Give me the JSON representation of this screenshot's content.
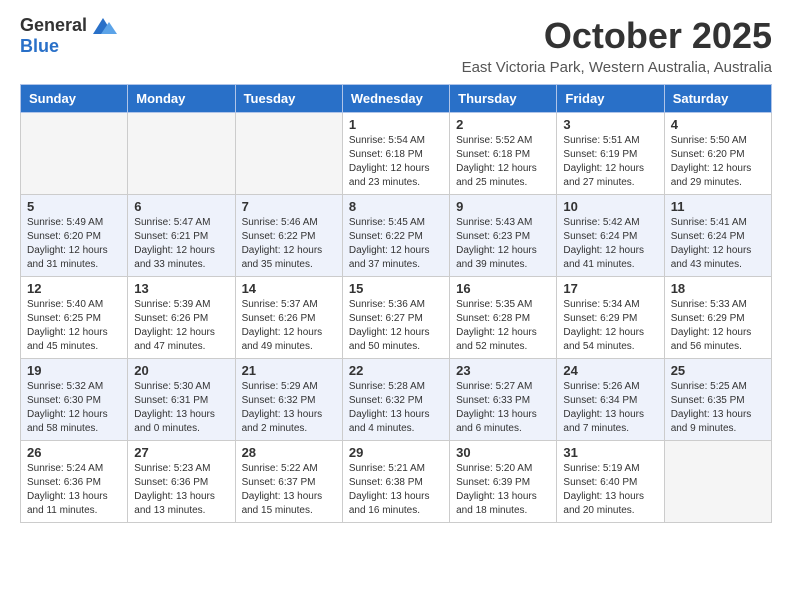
{
  "header": {
    "logo_general": "General",
    "logo_blue": "Blue",
    "title": "October 2025",
    "subtitle": "East Victoria Park, Western Australia, Australia"
  },
  "weekdays": [
    "Sunday",
    "Monday",
    "Tuesday",
    "Wednesday",
    "Thursday",
    "Friday",
    "Saturday"
  ],
  "weeks": [
    [
      {
        "day": "",
        "info": ""
      },
      {
        "day": "",
        "info": ""
      },
      {
        "day": "",
        "info": ""
      },
      {
        "day": "1",
        "info": "Sunrise: 5:54 AM\nSunset: 6:18 PM\nDaylight: 12 hours\nand 23 minutes."
      },
      {
        "day": "2",
        "info": "Sunrise: 5:52 AM\nSunset: 6:18 PM\nDaylight: 12 hours\nand 25 minutes."
      },
      {
        "day": "3",
        "info": "Sunrise: 5:51 AM\nSunset: 6:19 PM\nDaylight: 12 hours\nand 27 minutes."
      },
      {
        "day": "4",
        "info": "Sunrise: 5:50 AM\nSunset: 6:20 PM\nDaylight: 12 hours\nand 29 minutes."
      }
    ],
    [
      {
        "day": "5",
        "info": "Sunrise: 5:49 AM\nSunset: 6:20 PM\nDaylight: 12 hours\nand 31 minutes."
      },
      {
        "day": "6",
        "info": "Sunrise: 5:47 AM\nSunset: 6:21 PM\nDaylight: 12 hours\nand 33 minutes."
      },
      {
        "day": "7",
        "info": "Sunrise: 5:46 AM\nSunset: 6:22 PM\nDaylight: 12 hours\nand 35 minutes."
      },
      {
        "day": "8",
        "info": "Sunrise: 5:45 AM\nSunset: 6:22 PM\nDaylight: 12 hours\nand 37 minutes."
      },
      {
        "day": "9",
        "info": "Sunrise: 5:43 AM\nSunset: 6:23 PM\nDaylight: 12 hours\nand 39 minutes."
      },
      {
        "day": "10",
        "info": "Sunrise: 5:42 AM\nSunset: 6:24 PM\nDaylight: 12 hours\nand 41 minutes."
      },
      {
        "day": "11",
        "info": "Sunrise: 5:41 AM\nSunset: 6:24 PM\nDaylight: 12 hours\nand 43 minutes."
      }
    ],
    [
      {
        "day": "12",
        "info": "Sunrise: 5:40 AM\nSunset: 6:25 PM\nDaylight: 12 hours\nand 45 minutes."
      },
      {
        "day": "13",
        "info": "Sunrise: 5:39 AM\nSunset: 6:26 PM\nDaylight: 12 hours\nand 47 minutes."
      },
      {
        "day": "14",
        "info": "Sunrise: 5:37 AM\nSunset: 6:26 PM\nDaylight: 12 hours\nand 49 minutes."
      },
      {
        "day": "15",
        "info": "Sunrise: 5:36 AM\nSunset: 6:27 PM\nDaylight: 12 hours\nand 50 minutes."
      },
      {
        "day": "16",
        "info": "Sunrise: 5:35 AM\nSunset: 6:28 PM\nDaylight: 12 hours\nand 52 minutes."
      },
      {
        "day": "17",
        "info": "Sunrise: 5:34 AM\nSunset: 6:29 PM\nDaylight: 12 hours\nand 54 minutes."
      },
      {
        "day": "18",
        "info": "Sunrise: 5:33 AM\nSunset: 6:29 PM\nDaylight: 12 hours\nand 56 minutes."
      }
    ],
    [
      {
        "day": "19",
        "info": "Sunrise: 5:32 AM\nSunset: 6:30 PM\nDaylight: 12 hours\nand 58 minutes."
      },
      {
        "day": "20",
        "info": "Sunrise: 5:30 AM\nSunset: 6:31 PM\nDaylight: 13 hours\nand 0 minutes."
      },
      {
        "day": "21",
        "info": "Sunrise: 5:29 AM\nSunset: 6:32 PM\nDaylight: 13 hours\nand 2 minutes."
      },
      {
        "day": "22",
        "info": "Sunrise: 5:28 AM\nSunset: 6:32 PM\nDaylight: 13 hours\nand 4 minutes."
      },
      {
        "day": "23",
        "info": "Sunrise: 5:27 AM\nSunset: 6:33 PM\nDaylight: 13 hours\nand 6 minutes."
      },
      {
        "day": "24",
        "info": "Sunrise: 5:26 AM\nSunset: 6:34 PM\nDaylight: 13 hours\nand 7 minutes."
      },
      {
        "day": "25",
        "info": "Sunrise: 5:25 AM\nSunset: 6:35 PM\nDaylight: 13 hours\nand 9 minutes."
      }
    ],
    [
      {
        "day": "26",
        "info": "Sunrise: 5:24 AM\nSunset: 6:36 PM\nDaylight: 13 hours\nand 11 minutes."
      },
      {
        "day": "27",
        "info": "Sunrise: 5:23 AM\nSunset: 6:36 PM\nDaylight: 13 hours\nand 13 minutes."
      },
      {
        "day": "28",
        "info": "Sunrise: 5:22 AM\nSunset: 6:37 PM\nDaylight: 13 hours\nand 15 minutes."
      },
      {
        "day": "29",
        "info": "Sunrise: 5:21 AM\nSunset: 6:38 PM\nDaylight: 13 hours\nand 16 minutes."
      },
      {
        "day": "30",
        "info": "Sunrise: 5:20 AM\nSunset: 6:39 PM\nDaylight: 13 hours\nand 18 minutes."
      },
      {
        "day": "31",
        "info": "Sunrise: 5:19 AM\nSunset: 6:40 PM\nDaylight: 13 hours\nand 20 minutes."
      },
      {
        "day": "",
        "info": ""
      }
    ]
  ]
}
